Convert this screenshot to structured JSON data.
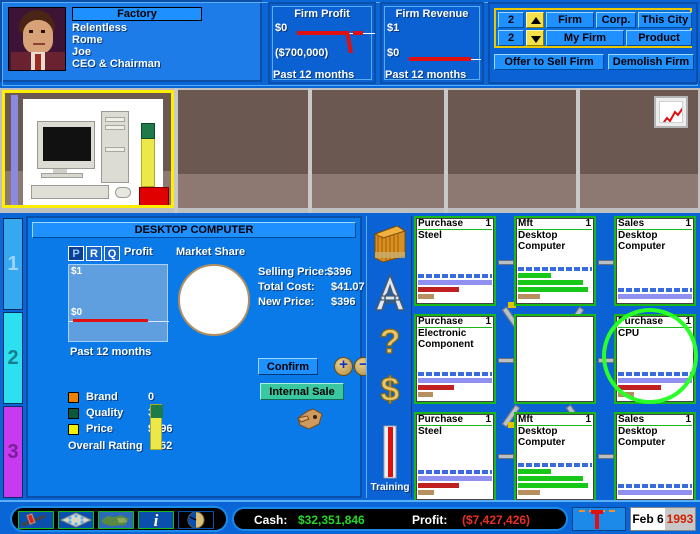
{
  "ceo": {
    "company_label": "Factory",
    "lines": [
      "Relentless",
      "Rome",
      "Joe",
      "CEO & Chairman"
    ],
    "portrait_icon": "ceo-portrait-photo",
    "logo_icon": "company-logo-cubes"
  },
  "firm_profit": {
    "title": "Firm Profit",
    "top_label": "$0",
    "bottom_label": "($700,000)",
    "footer": "Past 12 months"
  },
  "firm_revenue": {
    "title": "Firm Revenue",
    "top_label": "$1",
    "bottom_label": "$0",
    "footer": "Past 12 months"
  },
  "selector": {
    "row1_number": "2",
    "row2_number": "2",
    "up_arrow_icon": "arrow-up-icon",
    "down_arrow_icon": "arrow-down-icon",
    "firm_label": "Firm",
    "corp_label": "Corp.",
    "this_city_label": "This City",
    "my_firm_label": "My Firm",
    "product_label": "Product",
    "offer_to_sell_label": "Offer to Sell Firm",
    "demolish_label": "Demolish Firm"
  },
  "tabs": [
    {
      "label": "1",
      "selected": true
    },
    {
      "label": "2",
      "selected": false
    },
    {
      "label": "3",
      "selected": false
    }
  ],
  "building_strip": {
    "chart_tile_icon": "line-chart-icon",
    "lot_photo_icon": "desktop-computer-photo"
  },
  "product": {
    "title": "DESKTOP COMPUTER",
    "mode_buttons": [
      {
        "label": "P",
        "active": true
      },
      {
        "label": "R",
        "active": false
      },
      {
        "label": "Q",
        "active": false
      }
    ],
    "profit_label": "Profit",
    "profit_y_top": "$1",
    "profit_y_bottom": "$0",
    "profit_footer": "Past 12 months",
    "market_share_label": "Market Share",
    "selling_price_label": "Selling Price:",
    "selling_price_value": "$396",
    "total_cost_label": "Total Cost:",
    "total_cost_value": "$41.07",
    "new_price_label": "New Price:",
    "new_price_value": "$396",
    "confirm_label": "Confirm",
    "plus_icon": "plus-icon",
    "minus_icon": "minus-icon",
    "internal_sale_label": "Internal Sale",
    "ratings": [
      {
        "name": "Brand",
        "value": "0",
        "color": "#f08000"
      },
      {
        "name": "Quality",
        "value": "34",
        "color": "#0a5a3a"
      },
      {
        "name": "Price",
        "value": "$396",
        "color": "#f0f000"
      }
    ],
    "overall_label": "Overall Rating",
    "overall_value": "62",
    "hand_cursor_icon": "pointing-hand-icon"
  },
  "icon_column": {
    "inventory_icon": "inventory-crate-icon",
    "advertising_icon": "advertising-a-icon",
    "help_icon": "question-mark-icon",
    "finance_icon": "dollar-sign-icon",
    "training_icon": "training-bar-icon",
    "training_label": "Training"
  },
  "grid": {
    "cells": [
      {
        "kind": "Purchase",
        "count": "1",
        "product": "Steel",
        "empty": false,
        "ring": false,
        "bars": [
          {
            "t": "dash",
            "c": "#3a6ae0",
            "w": 100
          },
          {
            "t": "solid",
            "c": "#9090f0",
            "w": 100
          },
          {
            "t": "solid",
            "c": "#c02020",
            "w": 55
          },
          {
            "t": "solid",
            "c": "#b89060",
            "w": 22
          }
        ]
      },
      {
        "kind": "Mft",
        "count": "1",
        "product": "Desktop Computer",
        "empty": false,
        "ring": false,
        "bars": [
          {
            "t": "dash",
            "c": "#3a6ae0",
            "w": 100
          },
          {
            "t": "solid",
            "c": "#18c818",
            "w": 45
          },
          {
            "t": "solid",
            "c": "#18c818",
            "w": 88
          },
          {
            "t": "solid",
            "c": "#18c818",
            "w": 95
          },
          {
            "t": "solid",
            "c": "#b89060",
            "w": 30
          }
        ]
      },
      {
        "kind": "Sales",
        "count": "1",
        "product": "Desktop Computer",
        "empty": false,
        "ring": false,
        "bars": [
          {
            "t": "dash",
            "c": "#3a6ae0",
            "w": 100
          },
          {
            "t": "solid",
            "c": "#9090f0",
            "w": 100
          }
        ]
      },
      {
        "kind": "Purchase",
        "count": "1",
        "product": "Electronic Component",
        "empty": false,
        "ring": false,
        "bars": [
          {
            "t": "dash",
            "c": "#3a6ae0",
            "w": 100
          },
          {
            "t": "solid",
            "c": "#9090f0",
            "w": 100
          },
          {
            "t": "solid",
            "c": "#c02020",
            "w": 48
          },
          {
            "t": "solid",
            "c": "#b89060",
            "w": 20
          }
        ]
      },
      {
        "kind": "",
        "count": "",
        "product": "",
        "empty": true,
        "ring": false,
        "bars": []
      },
      {
        "kind": "Purchase",
        "count": "1",
        "product": "CPU",
        "empty": false,
        "ring": true,
        "bars": [
          {
            "t": "dash",
            "c": "#3a6ae0",
            "w": 100
          },
          {
            "t": "solid",
            "c": "#9090f0",
            "w": 100
          },
          {
            "t": "solid",
            "c": "#c02020",
            "w": 58
          },
          {
            "t": "solid",
            "c": "#b89060",
            "w": 22
          }
        ]
      },
      {
        "kind": "Purchase",
        "count": "1",
        "product": "Steel",
        "empty": false,
        "ring": false,
        "bars": [
          {
            "t": "dash",
            "c": "#3a6ae0",
            "w": 100
          },
          {
            "t": "solid",
            "c": "#9090f0",
            "w": 100
          },
          {
            "t": "solid",
            "c": "#c02020",
            "w": 55
          },
          {
            "t": "solid",
            "c": "#b89060",
            "w": 22
          }
        ]
      },
      {
        "kind": "Mft",
        "count": "1",
        "product": "Desktop Computer",
        "empty": false,
        "ring": false,
        "bars": [
          {
            "t": "dash",
            "c": "#3a6ae0",
            "w": 100
          },
          {
            "t": "solid",
            "c": "#18c818",
            "w": 45
          },
          {
            "t": "solid",
            "c": "#18c818",
            "w": 88
          },
          {
            "t": "solid",
            "c": "#18c818",
            "w": 95
          },
          {
            "t": "solid",
            "c": "#b89060",
            "w": 30
          }
        ]
      },
      {
        "kind": "Sales",
        "count": "1",
        "product": "Desktop Computer",
        "empty": false,
        "ring": false,
        "bars": [
          {
            "t": "dash",
            "c": "#3a6ae0",
            "w": 100
          },
          {
            "t": "solid",
            "c": "#9090f0",
            "w": 100
          }
        ]
      }
    ]
  },
  "bottombar": {
    "tools": [
      {
        "icon": "hammer-build-icon"
      },
      {
        "icon": "city-grid-icon"
      },
      {
        "icon": "world-map-icon"
      },
      {
        "icon": "info-icon"
      },
      {
        "icon": "clock-icon"
      }
    ],
    "cash_label": "Cash:",
    "cash_value": "$32,351,846",
    "cash_color": "#22d822",
    "profit_label": "Profit:",
    "profit_value": "($7,427,426)",
    "profit_color": "#e83020",
    "speed_icon": "speed-slider-icon",
    "date_month": "Feb 6",
    "date_year": "1993"
  }
}
